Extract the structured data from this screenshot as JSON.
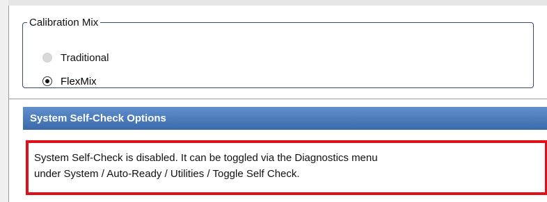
{
  "calibration": {
    "group_label": "Calibration Mix",
    "options": [
      {
        "label": "Traditional",
        "state": "disabled"
      },
      {
        "label": "FlexMix",
        "state": "checked"
      }
    ]
  },
  "self_check": {
    "header": "System Self-Check Options",
    "message_line1": "System Self-Check is disabled. It can be toggled via the Diagnostics menu",
    "message_line2": "under System / Auto-Ready / Utilities / Toggle Self Check."
  },
  "colors": {
    "header_gradient_top": "#5f8fcc",
    "header_gradient_bottom": "#3a6aa9",
    "highlight_border": "#e0101a"
  }
}
